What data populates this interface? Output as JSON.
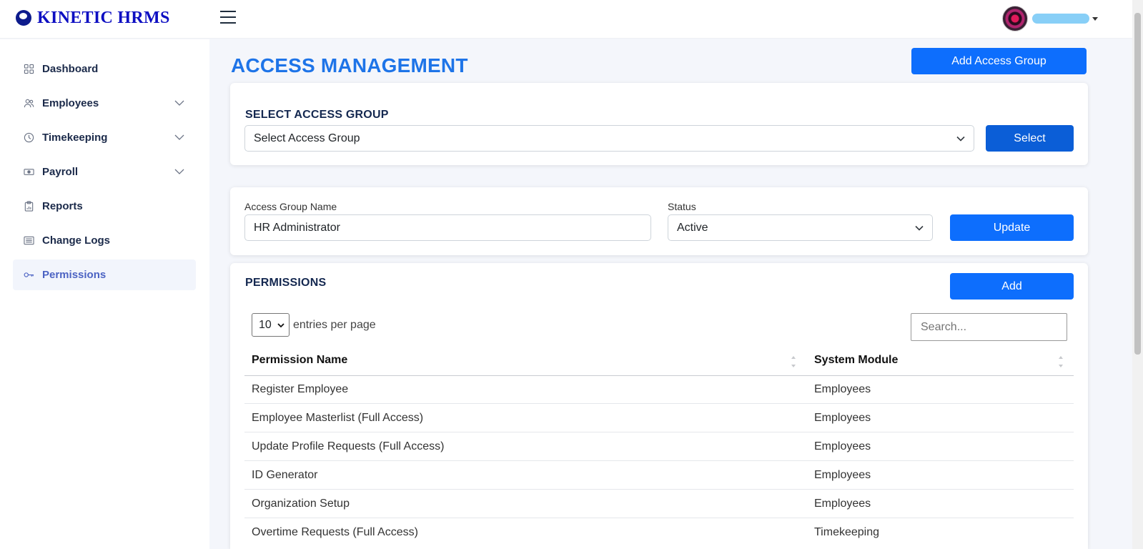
{
  "app": {
    "logo_text": "KINETIC HRMS"
  },
  "sidebar": {
    "items": [
      {
        "label": "Dashboard",
        "icon": "grid-icon"
      },
      {
        "label": "Employees",
        "icon": "people-icon"
      },
      {
        "label": "Timekeeping",
        "icon": "clock-icon"
      },
      {
        "label": "Payroll",
        "icon": "cash-icon"
      },
      {
        "label": "Reports",
        "icon": "clipboard-chart-icon"
      },
      {
        "label": "Change Logs",
        "icon": "list-icon"
      },
      {
        "label": "Permissions",
        "icon": "key-icon"
      }
    ],
    "active": "Permissions"
  },
  "page": {
    "title": "ACCESS MANAGEMENT",
    "add_group_label": "Add Access Group"
  },
  "select_group": {
    "heading": "SELECT ACCESS GROUP",
    "selected": "Select Access Group",
    "button_label": "Select"
  },
  "group_form": {
    "name_label": "Access Group Name",
    "name_value": "HR Administrator",
    "status_label": "Status",
    "status_value": "Active",
    "update_label": "Update"
  },
  "permissions": {
    "heading": "PERMISSIONS",
    "add_label": "Add",
    "per_page_value": "10",
    "per_page_label": "entries per page",
    "search_placeholder": "Search...",
    "columns": [
      "Permission Name",
      "System Module"
    ],
    "rows": [
      {
        "name": "Register Employee",
        "module": "Employees"
      },
      {
        "name": "Employee Masterlist (Full Access)",
        "module": "Employees"
      },
      {
        "name": "Update Profile Requests (Full Access)",
        "module": "Employees"
      },
      {
        "name": "ID Generator",
        "module": "Employees"
      },
      {
        "name": "Organization Setup",
        "module": "Employees"
      },
      {
        "name": "Overtime Requests (Full Access)",
        "module": "Timekeeping"
      }
    ]
  },
  "colors": {
    "primary": "#0d6efd",
    "title_blue": "#1e74e8",
    "logo_blue": "#0d0ec2",
    "active_nav_bg": "#f2f5fc"
  }
}
